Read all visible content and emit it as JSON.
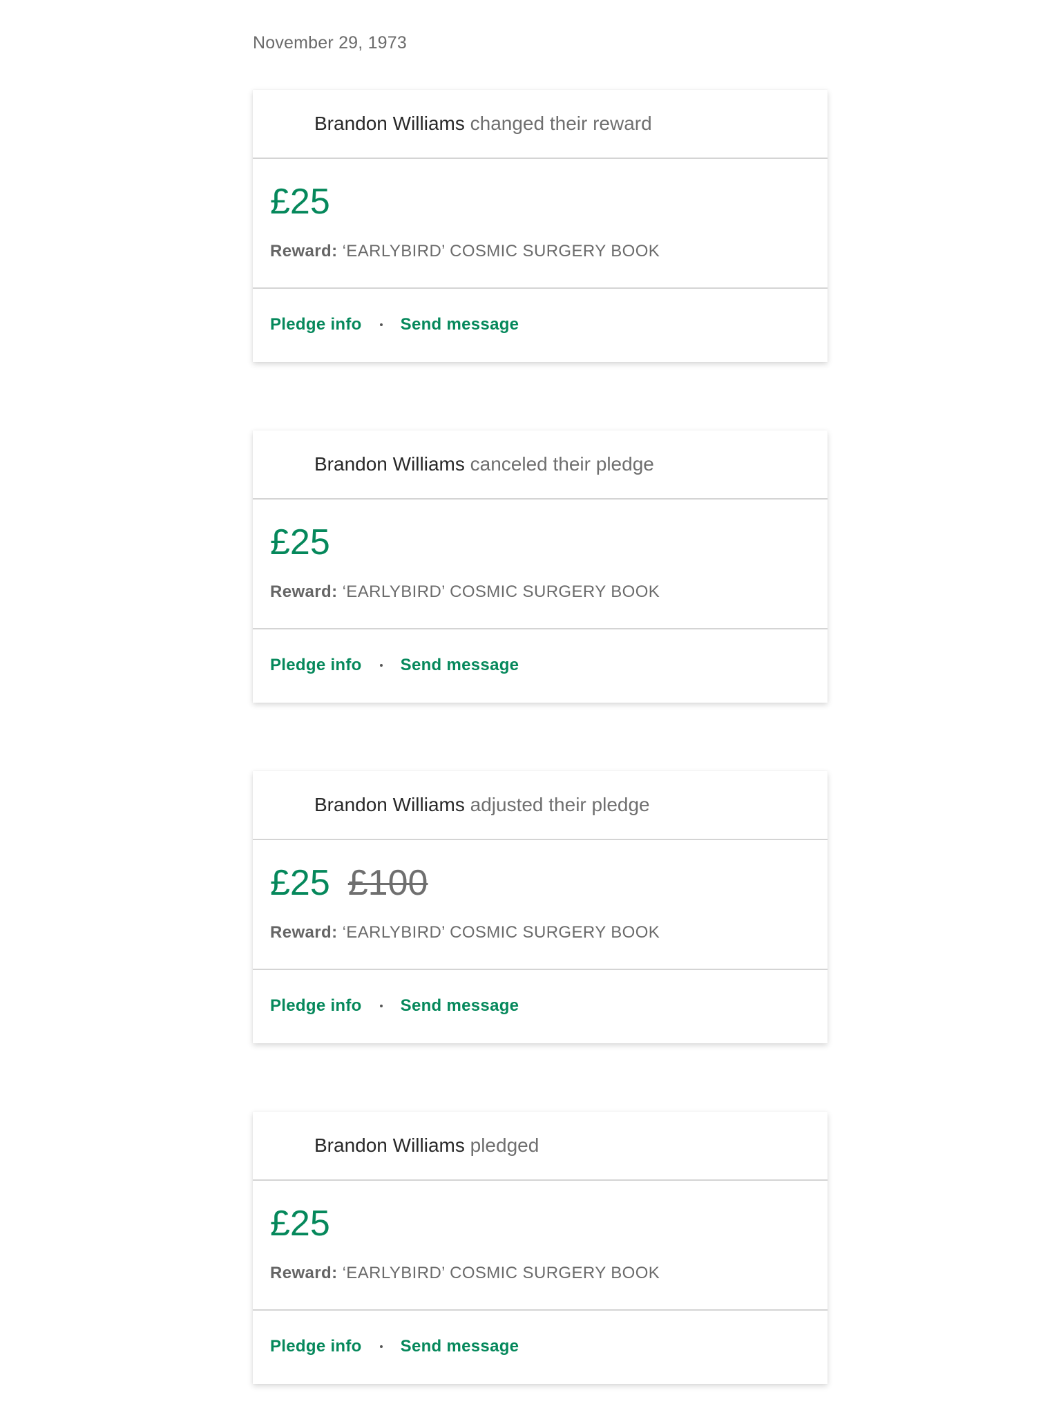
{
  "date": "November 29, 1973",
  "cards": [
    {
      "name": "Brandon Williams",
      "action": "changed their reward",
      "amount": "£25",
      "old_amount": "",
      "reward_label": "Reward:",
      "reward_value": "‘EARLYBIRD’ COSMIC SURGERY BOOK",
      "pledge_info": "Pledge info",
      "send_message": "Send message"
    },
    {
      "name": "Brandon Williams",
      "action": "canceled their pledge",
      "amount": "£25",
      "old_amount": "",
      "reward_label": "Reward:",
      "reward_value": "‘EARLYBIRD’ COSMIC SURGERY BOOK",
      "pledge_info": "Pledge info",
      "send_message": "Send message"
    },
    {
      "name": "Brandon Williams",
      "action": "adjusted their pledge",
      "amount": "£25",
      "old_amount": "£100",
      "reward_label": "Reward:",
      "reward_value": "‘EARLYBIRD’ COSMIC SURGERY BOOK",
      "pledge_info": "Pledge info",
      "send_message": "Send message"
    },
    {
      "name": "Brandon Williams",
      "action": "pledged",
      "amount": "£25",
      "old_amount": "",
      "reward_label": "Reward:",
      "reward_value": "‘EARLYBIRD’ COSMIC SURGERY BOOK",
      "pledge_info": "Pledge info",
      "send_message": "Send message"
    }
  ],
  "colors": {
    "accent": "#05885b",
    "muted": "#6f6f6f",
    "divider": "#d4d4d4"
  }
}
